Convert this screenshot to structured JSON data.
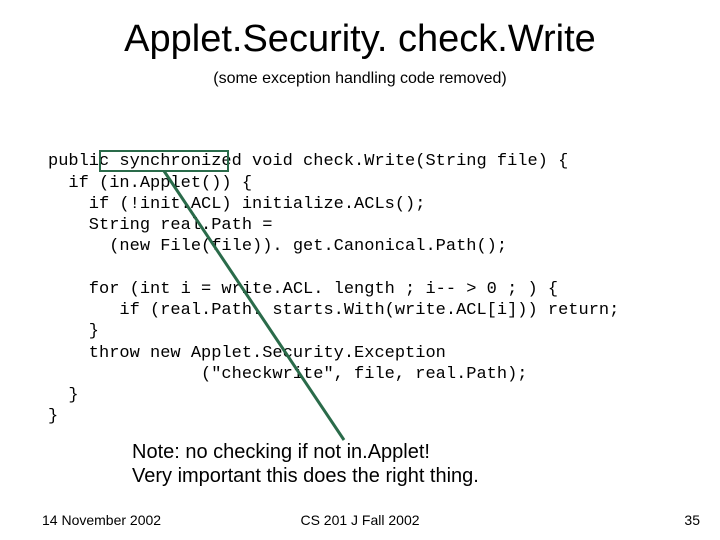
{
  "title": "Applet.Security. check.Write",
  "subtitle": "(some exception handling code removed)",
  "code_lines": [
    "public synchronized void check.Write(String file) {",
    "  if (in.Applet()) {",
    "    if (!init.ACL) initialize.ACLs();",
    "    String real.Path =",
    "      (new File(file)). get.Canonical.Path();",
    "",
    "    for (int i = write.ACL. length ; i-- > 0 ; ) {",
    "       if (real.Path. starts.With(write.ACL[i])) return;",
    "    }",
    "    throw new Applet.Security.Exception",
    "               (\"checkwrite\", file, real.Path);",
    "  }",
    "}"
  ],
  "note_line1": "Note: no checking if not in.Applet!",
  "note_line2": "Very important this does the right thing.",
  "footer": {
    "date": "14 November 2002",
    "course": "CS 201 J Fall 2002",
    "page": "35"
  },
  "annotation_color": "#2a6b4a"
}
